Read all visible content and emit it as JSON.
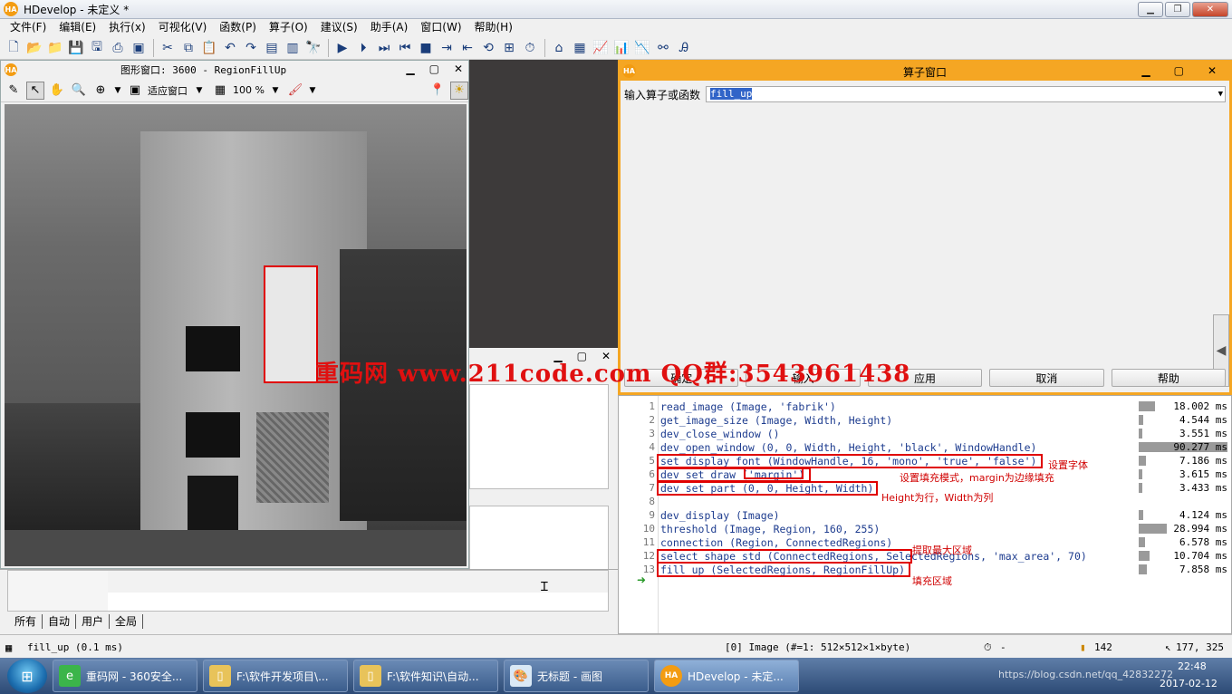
{
  "window": {
    "title": "HDevelop - 未定义 *"
  },
  "menu": [
    "文件(F)",
    "编辑(E)",
    "执行(x)",
    "可视化(V)",
    "函数(P)",
    "算子(O)",
    "建议(S)",
    "助手(A)",
    "窗口(W)",
    "帮助(H)"
  ],
  "graphics": {
    "title": "图形窗口: 3600 - RegionFillUp",
    "fit_label": "适应窗口",
    "zoom": "100 %"
  },
  "operator": {
    "title": "算子窗口",
    "input_label": "输入算子或函数",
    "input_value": "fill_up",
    "buttons": [
      "确定",
      "输入",
      "应用",
      "取消",
      "帮助"
    ]
  },
  "program": {
    "lines": [
      {
        "n": "1",
        "code": "read_image (Image, 'fabrik')",
        "time": "18.002 ms",
        "bar": 0.18
      },
      {
        "n": "2",
        "code": "get_image_size (Image, Width, Height)",
        "time": "4.544 ms",
        "bar": 0.05
      },
      {
        "n": "3",
        "code": "dev_close_window ()",
        "time": "3.551 ms",
        "bar": 0.04
      },
      {
        "n": "4",
        "code": "dev_open_window (0, 0, Width, Height, 'black', WindowHandle)",
        "time": "90.277 ms",
        "bar": 1.0
      },
      {
        "n": "5",
        "code": "set_display_font (WindowHandle, 16, 'mono', 'true', 'false')",
        "time": "7.186 ms",
        "bar": 0.08
      },
      {
        "n": "6",
        "code": "dev_set_draw ('margin')",
        "time": "3.615 ms",
        "bar": 0.04
      },
      {
        "n": "7",
        "code": "dev_set_part (0, 0, Height, Width)",
        "time": "3.433 ms",
        "bar": 0.04
      },
      {
        "n": "8",
        "code": "",
        "time": "",
        "bar": 0
      },
      {
        "n": "9",
        "code": "dev_display (Image)",
        "time": "4.124 ms",
        "bar": 0.05
      },
      {
        "n": "10",
        "code": "threshold (Image, Region, 160, 255)",
        "time": "28.994 ms",
        "bar": 0.32
      },
      {
        "n": "11",
        "code": "connection (Region, ConnectedRegions)",
        "time": "6.578 ms",
        "bar": 0.07
      },
      {
        "n": "12",
        "code": "select_shape_std (ConnectedRegions, SelectedRegions, 'max_area', 70)",
        "time": "10.704 ms",
        "bar": 0.12
      },
      {
        "n": "13",
        "code": "fill_up (SelectedRegions, RegionFillUp)",
        "time": "7.858 ms",
        "bar": 0.09
      }
    ],
    "annotations": {
      "font": "设置字体",
      "draw": "设置填充模式，margin为边缘填充",
      "part": "Height为行，Width为列",
      "select": "提取最大区域",
      "fill": "填充区域"
    }
  },
  "watermark": "重码网 www.211code.com  QQ群:3543961438",
  "bottom_tabs": [
    "所有",
    "自动",
    "用户",
    "全局"
  ],
  "status": {
    "left": "fill_up  (0.1 ms)",
    "image_info": "[0] Image (#=1: 512×512×1×byte)",
    "timer": "-",
    "value": "142",
    "coords": "177, 325"
  },
  "taskbar": {
    "items": [
      "重码网 - 360安全...",
      "F:\\软件开发项目\\...",
      "F:\\软件知识\\自动...",
      "无标题 - 画图",
      "HDevelop - 未定..."
    ],
    "clock_time": "22:48",
    "clock_date": "2017-02-12",
    "url": "https://blog.csdn.net/qq_42832272"
  },
  "colors": {
    "accent": "#f5a623",
    "code": "#1d3c8f",
    "annotation": "#e00000"
  }
}
